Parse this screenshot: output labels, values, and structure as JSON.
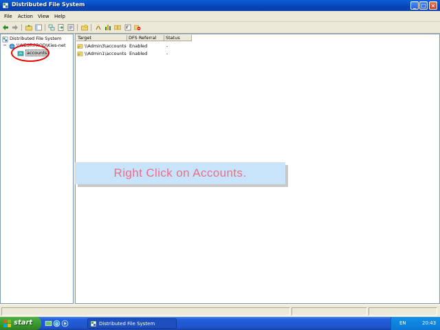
{
  "window": {
    "title": "Distributed File System",
    "controls": [
      "_",
      "□",
      "×"
    ]
  },
  "menu": [
    "File",
    "Action",
    "View",
    "Help"
  ],
  "tree": {
    "root": "Distributed File System",
    "child": "\\\\WEST.PROD\\Kies-net",
    "leaf": "accounts"
  },
  "table": {
    "columns": [
      "Target",
      "DFS Referral",
      "Status"
    ],
    "rows": [
      {
        "target": "\\\\Admin3\\accounts",
        "referral": "Enabled",
        "status": "-"
      },
      {
        "target": "\\\\Admin1\\accounts",
        "referral": "Enabled",
        "status": "-"
      }
    ]
  },
  "callout": {
    "text": "Right Click on Accounts."
  },
  "taskbar": {
    "start_label": "start",
    "task_label": "Distributed File System",
    "lang": "EN",
    "clock": "20:43"
  },
  "colors": {
    "accent": "#0a5fd8",
    "callout_bg": "#c8e4fb",
    "callout_text": "#ef6b86",
    "highlight_ring": "#e00000"
  }
}
